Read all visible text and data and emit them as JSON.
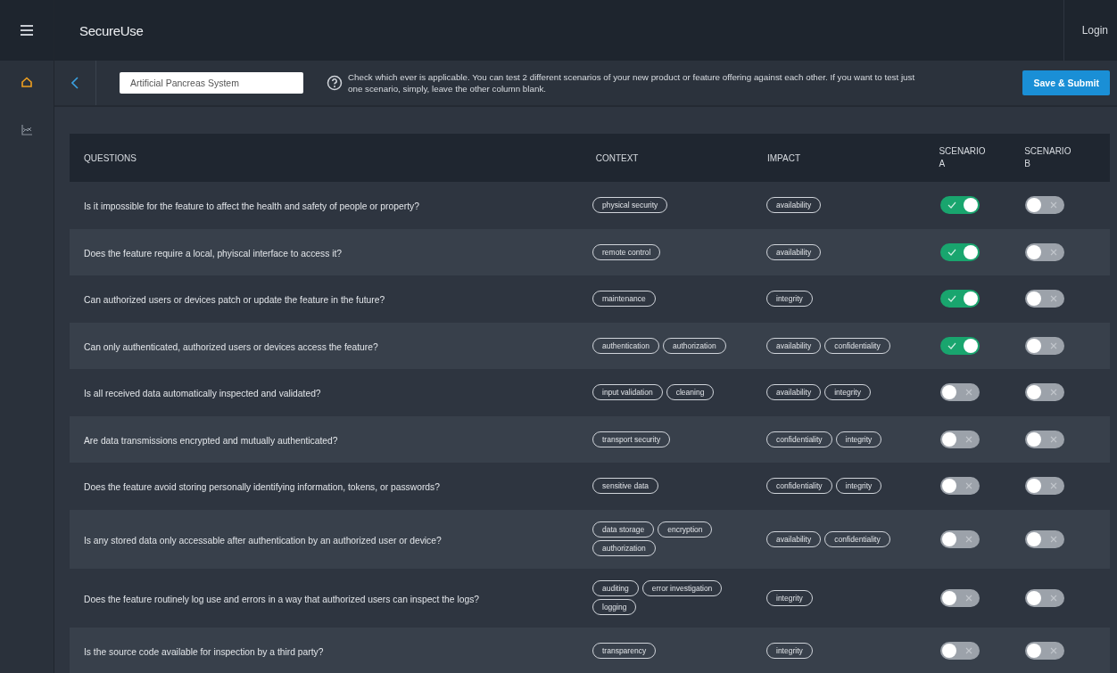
{
  "app": {
    "logo": "SecureUse",
    "login": "Login"
  },
  "sidebar": {
    "items": [
      {
        "selected": true
      },
      {
        "selected": false
      }
    ]
  },
  "toolbar": {
    "product_name": "Artificial Pancreas System",
    "help_text": "Check which ever is applicable. You can test 2 different scenarios of your new product or feature offering against each other. If you want to test just one scenario, simply, leave the other column blank.",
    "submit": "Save & Submit"
  },
  "table": {
    "columns": [
      "QUESTIONS",
      "CONTEXT",
      "IMPACT",
      "SCENARIO A",
      "SCENARIO B"
    ],
    "rows": [
      {
        "question": "Is it impossible for the feature to affect the health and safety of people or property?",
        "context": [
          "physical security"
        ],
        "impact": [
          "availability"
        ],
        "scenario_a": true,
        "scenario_b": false
      },
      {
        "question": "Does the feature require a local, phyiscal interface to access it?",
        "context": [
          "remote control"
        ],
        "impact": [
          "availability"
        ],
        "scenario_a": true,
        "scenario_b": false
      },
      {
        "question": "Can authorized users or devices patch or update the feature in the future?",
        "context": [
          "maintenance"
        ],
        "impact": [
          "integrity"
        ],
        "scenario_a": true,
        "scenario_b": false
      },
      {
        "question": "Can only authenticated, authorized users or devices access the feature?",
        "context": [
          "authentication",
          "authorization"
        ],
        "impact": [
          "availability",
          "confidentiality"
        ],
        "scenario_a": true,
        "scenario_b": false
      },
      {
        "question": "Is all received data automatically inspected and validated?",
        "context": [
          "input validation",
          "cleaning"
        ],
        "impact": [
          "availability",
          "integrity"
        ],
        "scenario_a": false,
        "scenario_b": false
      },
      {
        "question": "Are data transmissions encrypted and mutually authenticated?",
        "context": [
          "transport security"
        ],
        "impact": [
          "confidentiality",
          "integrity"
        ],
        "scenario_a": false,
        "scenario_b": false
      },
      {
        "question": "Does the feature avoid storing personally identifying information, tokens, or passwords?",
        "context": [
          "sensitive data"
        ],
        "impact": [
          "confidentiality",
          "integrity"
        ],
        "scenario_a": false,
        "scenario_b": false
      },
      {
        "question": "Is any stored data only accessable after authentication by an authorized user or device?",
        "context": [
          "data storage",
          "encryption",
          "authorization"
        ],
        "impact": [
          "availability",
          "confidentiality"
        ],
        "scenario_a": false,
        "scenario_b": false
      },
      {
        "question": "Does the feature routinely log use and errors in a way that authorized users can inspect the logs?",
        "context": [
          "auditing",
          "error investigation",
          "logging"
        ],
        "impact": [
          "integrity"
        ],
        "scenario_a": false,
        "scenario_b": false
      },
      {
        "question": "Is the source code available for inspection by a third party?",
        "context": [
          "transparency"
        ],
        "impact": [
          "integrity"
        ],
        "scenario_a": false,
        "scenario_b": false
      }
    ]
  }
}
